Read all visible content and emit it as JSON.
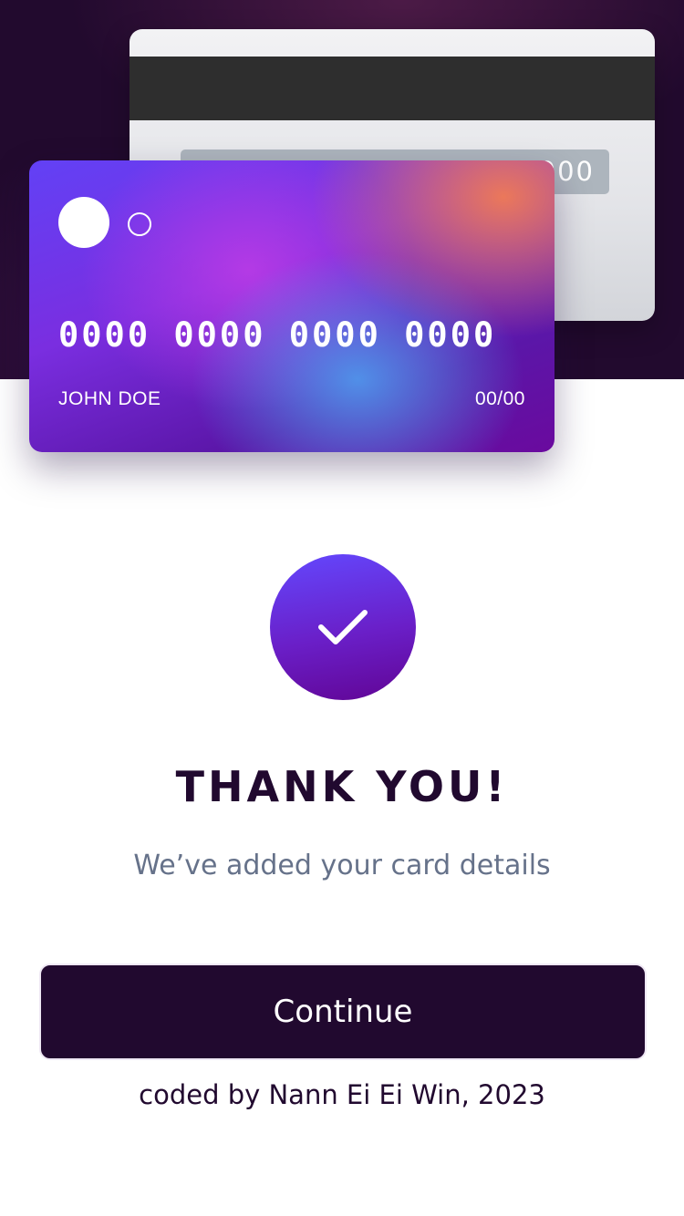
{
  "card_back": {
    "cvc": "000"
  },
  "card_front": {
    "number": "0000 0000 0000 0000",
    "holder_name": "JOHN DOE",
    "expiry": "00/00"
  },
  "success": {
    "icon": "check-icon",
    "title": "THANK YOU!",
    "message": "We’ve added your card details"
  },
  "actions": {
    "continue_label": "Continue"
  },
  "footer": {
    "credit": "coded by Nann Ei Ei Win, 2023"
  },
  "colors": {
    "dark": "#21092f",
    "accent_start": "#6348fe",
    "accent_end": "#610595",
    "muted_text": "#66728a"
  }
}
